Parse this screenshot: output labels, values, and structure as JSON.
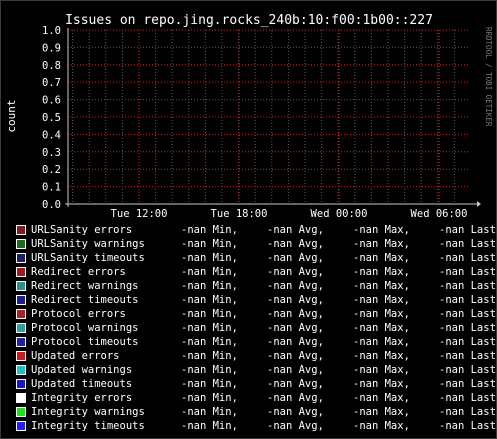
{
  "chart_data": {
    "type": "line",
    "title": "Issues on repo.jing.rocks_240b:10:f00:1b00::227",
    "ylabel": "count",
    "xlabel": "",
    "watermark": "RRDTOOL / TOBI OETIKER",
    "ylim": [
      0.0,
      1.0
    ],
    "y_ticks": [
      "0.0",
      "0.1",
      "0.2",
      "0.3",
      "0.4",
      "0.5",
      "0.6",
      "0.7",
      "0.8",
      "0.9",
      "1.0"
    ],
    "x_ticks": [
      "Tue 12:00",
      "Tue 18:00",
      "Wed 00:00",
      "Wed 06:00"
    ],
    "grid": true,
    "colors": {
      "background": "#000000",
      "canvas": "#000000",
      "major_grid": "#d81e1e",
      "minor_grid": "#5a5a5a",
      "axis": "#c8c8c8",
      "text": "#ffffff"
    },
    "series": [
      {
        "name": "URLSanity errors",
        "color": "#7a1e1e",
        "min": "-nan Min,",
        "avg": "-nan Avg,",
        "max": "-nan Max,",
        "last": "-nan Last"
      },
      {
        "name": "URLSanity warnings",
        "color": "#1e6b1e",
        "min": "-nan Min,",
        "avg": "-nan Avg,",
        "max": "-nan Max,",
        "last": "-nan Last"
      },
      {
        "name": "URLSanity timeouts",
        "color": "#1e1e6b",
        "min": "-nan Min,",
        "avg": "-nan Avg,",
        "max": "-nan Max,",
        "last": "-nan Last"
      },
      {
        "name": "Redirect errors",
        "color": "#a01c1c",
        "min": "-nan Min,",
        "avg": "-nan Avg,",
        "max": "-nan Max,",
        "last": "-nan Last"
      },
      {
        "name": "Redirect warnings",
        "color": "#2a9090",
        "min": "-nan Min,",
        "avg": "-nan Avg,",
        "max": "-nan Max,",
        "last": "-nan Last"
      },
      {
        "name": "Redirect timeouts",
        "color": "#1e1e90",
        "min": "-nan Min,",
        "avg": "-nan Avg,",
        "max": "-nan Max,",
        "last": "-nan Last"
      },
      {
        "name": "Protocol errors",
        "color": "#b02020",
        "min": "-nan Min,",
        "avg": "-nan Avg,",
        "max": "-nan Max,",
        "last": "-nan Last"
      },
      {
        "name": "Protocol warnings",
        "color": "#30a0a0",
        "min": "-nan Min,",
        "avg": "-nan Avg,",
        "max": "-nan Max,",
        "last": "-nan Last"
      },
      {
        "name": "Protocol timeouts",
        "color": "#2020a8",
        "min": "-nan Min,",
        "avg": "-nan Avg,",
        "max": "-nan Max,",
        "last": "-nan Last"
      },
      {
        "name": "Updated errors",
        "color": "#d01818",
        "min": "-nan Min,",
        "avg": "-nan Avg,",
        "max": "-nan Max,",
        "last": "-nan Last"
      },
      {
        "name": "Updated warnings",
        "color": "#20c0c0",
        "min": "-nan Min,",
        "avg": "-nan Avg,",
        "max": "-nan Max,",
        "last": "-nan Last"
      },
      {
        "name": "Updated timeouts",
        "color": "#1818c8",
        "min": "-nan Min,",
        "avg": "-nan Avg,",
        "max": "-nan Max,",
        "last": "-nan Last"
      },
      {
        "name": "Integrity errors",
        "color": "#ffffff",
        "min": "-nan Min,",
        "avg": "-nan Avg,",
        "max": "-nan Max,",
        "last": "-nan Last"
      },
      {
        "name": "Integrity warnings",
        "color": "#20e020",
        "min": "-nan Min,",
        "avg": "-nan Avg,",
        "max": "-nan Max,",
        "last": "-nan Last"
      },
      {
        "name": "Integrity timeouts",
        "color": "#2020f0",
        "min": "-nan Min,",
        "avg": "-nan Avg,",
        "max": "-nan Max,",
        "last": "-nan Last"
      }
    ]
  }
}
